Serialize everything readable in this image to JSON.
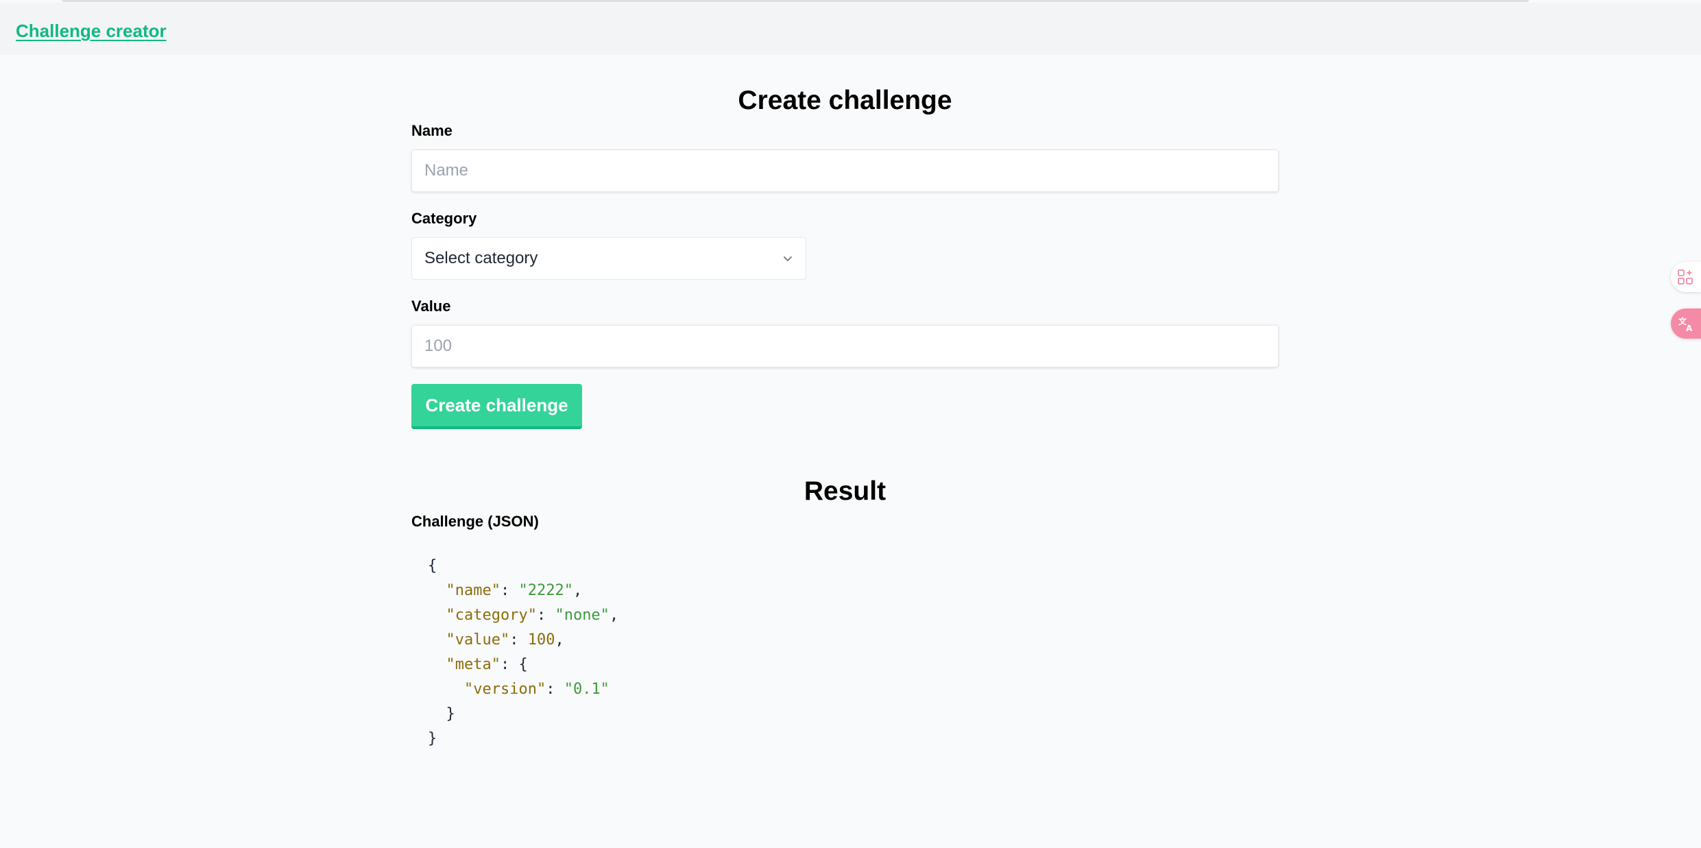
{
  "header": {
    "brand_link": "Challenge creator"
  },
  "form": {
    "title": "Create challenge",
    "name_label": "Name",
    "name_placeholder": "Name",
    "name_value": "",
    "category_label": "Category",
    "category_selected": "Select category",
    "value_label": "Value",
    "value_placeholder": "100",
    "value_value": "",
    "submit_label": "Create challenge"
  },
  "result": {
    "title": "Result",
    "json_label": "Challenge (JSON)",
    "json": {
      "open": "{",
      "close": "}",
      "entries": [
        {
          "key": "\"name\"",
          "value": "\"2222\"",
          "kind": "str",
          "tail": ","
        },
        {
          "key": "\"category\"",
          "value": "\"none\"",
          "kind": "str",
          "tail": ","
        },
        {
          "key": "\"value\"",
          "value": "100",
          "kind": "num",
          "tail": ","
        }
      ],
      "meta_key": "\"meta\"",
      "meta_open": "{",
      "meta_close": "}",
      "meta_entry_key": "\"version\"",
      "meta_entry_value": "\"0.1\""
    }
  },
  "side_tools": {
    "apps_icon": "apps-sparkle-icon",
    "translate_icon": "translate-icon"
  },
  "colors": {
    "accent": "#10b981",
    "button": "#34d399",
    "json_key": "#8a6d0b",
    "json_string": "#3d9a3d",
    "translate_badge": "#f58aa6"
  }
}
